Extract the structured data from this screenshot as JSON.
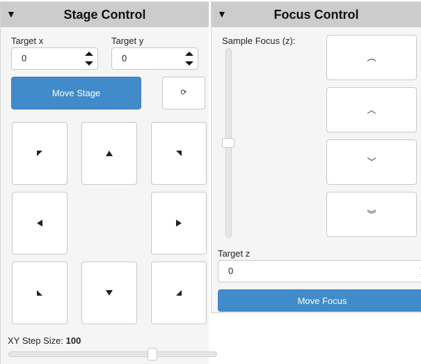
{
  "stage": {
    "title": "Stage Control",
    "collapse_icon": "▼",
    "target_x": {
      "label": "Target x",
      "value": "0"
    },
    "target_y": {
      "label": "Target y",
      "value": "0"
    },
    "move_button": "Move Stage",
    "refresh_icon": "⟳",
    "directions": [
      "up-left",
      "up",
      "up-right",
      "left",
      "right",
      "down-left",
      "down",
      "down-right"
    ],
    "step_size": {
      "label": "XY Step Size:",
      "value": "100",
      "slider_fraction": 0.7
    }
  },
  "focus": {
    "title": "Focus Control",
    "collapse_icon": "▼",
    "sample_focus_label": "Sample Focus (z):",
    "slider_fraction": 0.5,
    "buttons": [
      {
        "name": "focus-up-coarse",
        "glyph": "︵"
      },
      {
        "name": "focus-up-fine",
        "glyph": "︿"
      },
      {
        "name": "focus-down-fine",
        "glyph": "﹀"
      },
      {
        "name": "focus-down-coarse",
        "glyph": "︾"
      }
    ],
    "target_z": {
      "label": "Target z",
      "value": "0"
    },
    "move_button": "Move Focus"
  },
  "colors": {
    "primary": "#428bca",
    "header_bg": "#cccccc",
    "panel_bg": "#f5f5f5"
  }
}
